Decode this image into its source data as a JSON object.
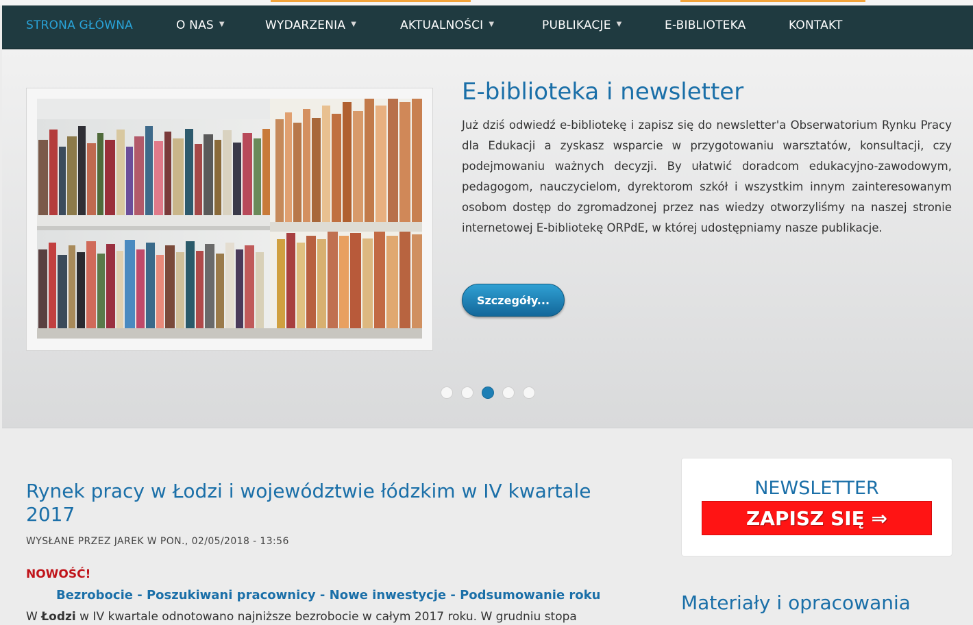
{
  "nav": {
    "items": [
      {
        "label": "STRONA GŁÓWNA",
        "active": true
      },
      {
        "label": "O NAS",
        "dropdown": true
      },
      {
        "label": "WYDARZENIA",
        "dropdown": true
      },
      {
        "label": "AKTUALNOŚCI",
        "dropdown": true
      },
      {
        "label": "PUBLIKACJE",
        "dropdown": true
      },
      {
        "label": "E-BIBLIOTEKA"
      },
      {
        "label": "KONTAKT"
      }
    ],
    "caret_glyph": "▼"
  },
  "slider": {
    "title": "E-biblioteka i newsletter",
    "body": "Już dziś odwiedź e-bibliotekę i zapisz się do newsletter'a Obserwatorium Rynku Pracy dla Edukacji a zyskasz wsparcie w przygotowaniu warsztatów, konsultacji, czy podejmowaniu ważnych decyzji. By ułatwić doradcom edukacyjno-zawodowym, pedagogom, nauczycielom, dyrektorom szkół i wszystkim innym zainteresowanym osobom dostęp do zgromadzonej przez nas wiedzy otworzyliśmy na naszej stronie internetowej E-bibliotekę ORPdE, w której udostępniamy nasze publikacje.",
    "button_label": "Szczegóły...",
    "image_icon": "bookshelf-photo",
    "slide_count": 5,
    "active_slide": 3
  },
  "article": {
    "title": "Rynek pracy w Łodzi i województwie łódzkim w IV kwartale 2017",
    "meta": "WYSŁANE PRZEZ JAREK W PON., 02/05/2018 - 13:56",
    "new_label": "NOWOŚĆ!",
    "sections_link": "Bezrobocie - Poszukiwani pracownicy - Nowe inwestycje - Podsumowanie roku",
    "text_prefix": "W ",
    "text_bold": "Łodzi",
    "text_rest": " w IV kwartale odnotowano najniższe bezrobocie w całym 2017 roku. W grudniu stopa"
  },
  "sidebar": {
    "newsletter_title": "NEWSLETTER",
    "subscribe_label": "ZAPISZ SIĘ ⇒",
    "materials_title": "Materiały i opracowania"
  },
  "colors": {
    "nav_bg": "#1f3a40",
    "accent_blue": "#1a6fa8",
    "subscribe_red": "#ff1414",
    "new_label_red": "#c0141a"
  }
}
